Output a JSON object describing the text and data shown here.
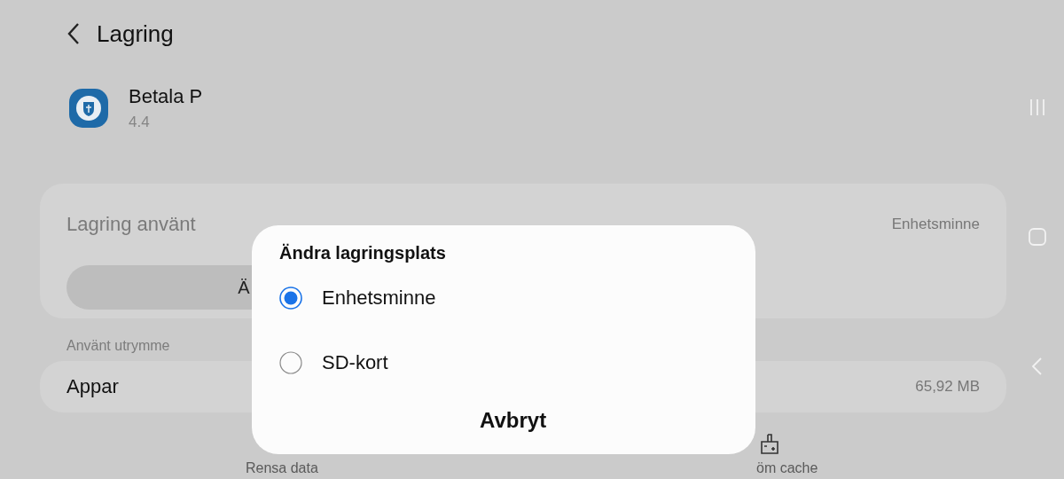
{
  "header": {
    "title": "Lagring"
  },
  "app": {
    "name": "Betala P",
    "version": "4.4"
  },
  "storage_card": {
    "label": "Lagring använt",
    "location": "Enhetsminne",
    "button_label": "Ä"
  },
  "section_label": "Använt utrymme",
  "usage_rows": [
    {
      "label": "Appar",
      "value": "65,92 MB"
    }
  ],
  "bottom_actions": [
    {
      "label": "Rensa data",
      "kind": "text"
    },
    {
      "label": "öm cache",
      "kind": "cache"
    }
  ],
  "dialog": {
    "title": "Ändra lagringsplats",
    "options": [
      {
        "label": "Enhetsminne",
        "selected": true
      },
      {
        "label": "SD-kort",
        "selected": false
      }
    ],
    "cancel": "Avbryt"
  }
}
